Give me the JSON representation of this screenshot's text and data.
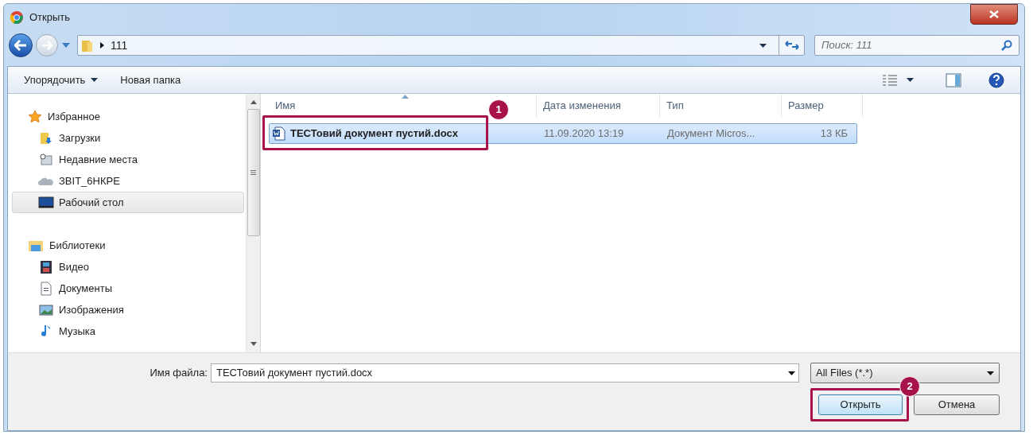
{
  "window": {
    "title": "Открыть"
  },
  "address": {
    "path": "111",
    "search_placeholder": "Поиск: 111"
  },
  "toolbar": {
    "organize": "Упорядочить",
    "new_folder": "Новая папка"
  },
  "sidebar": {
    "groups": [
      {
        "label": "Избранное",
        "items": [
          {
            "label": "Загрузки",
            "selected": false
          },
          {
            "label": "Недавние места",
            "selected": false
          },
          {
            "label": "ЗВІТ_6НКРЕ",
            "selected": false
          },
          {
            "label": "Рабочий стол",
            "selected": true
          }
        ]
      },
      {
        "label": "Библиотеки",
        "items": [
          {
            "label": "Видео",
            "selected": false
          },
          {
            "label": "Документы",
            "selected": false
          },
          {
            "label": "Изображения",
            "selected": false
          },
          {
            "label": "Музыка",
            "selected": false
          }
        ]
      }
    ]
  },
  "table": {
    "columns": [
      "Имя",
      "Дата изменения",
      "Тип",
      "Размер"
    ],
    "rows": [
      {
        "name": "ТЕСТовий документ пустий.docx",
        "date": "11.09.2020 13:19",
        "type": "Документ Micros...",
        "size": "13 КБ",
        "selected": true,
        "annotation": "1"
      }
    ]
  },
  "footer": {
    "filename_label": "Имя файла:",
    "filename": "ТЕСТовий документ пустий.docx",
    "filter": "All Files (*.*)",
    "open": "Открыть",
    "open_annotation": "2",
    "cancel": "Отмена"
  }
}
